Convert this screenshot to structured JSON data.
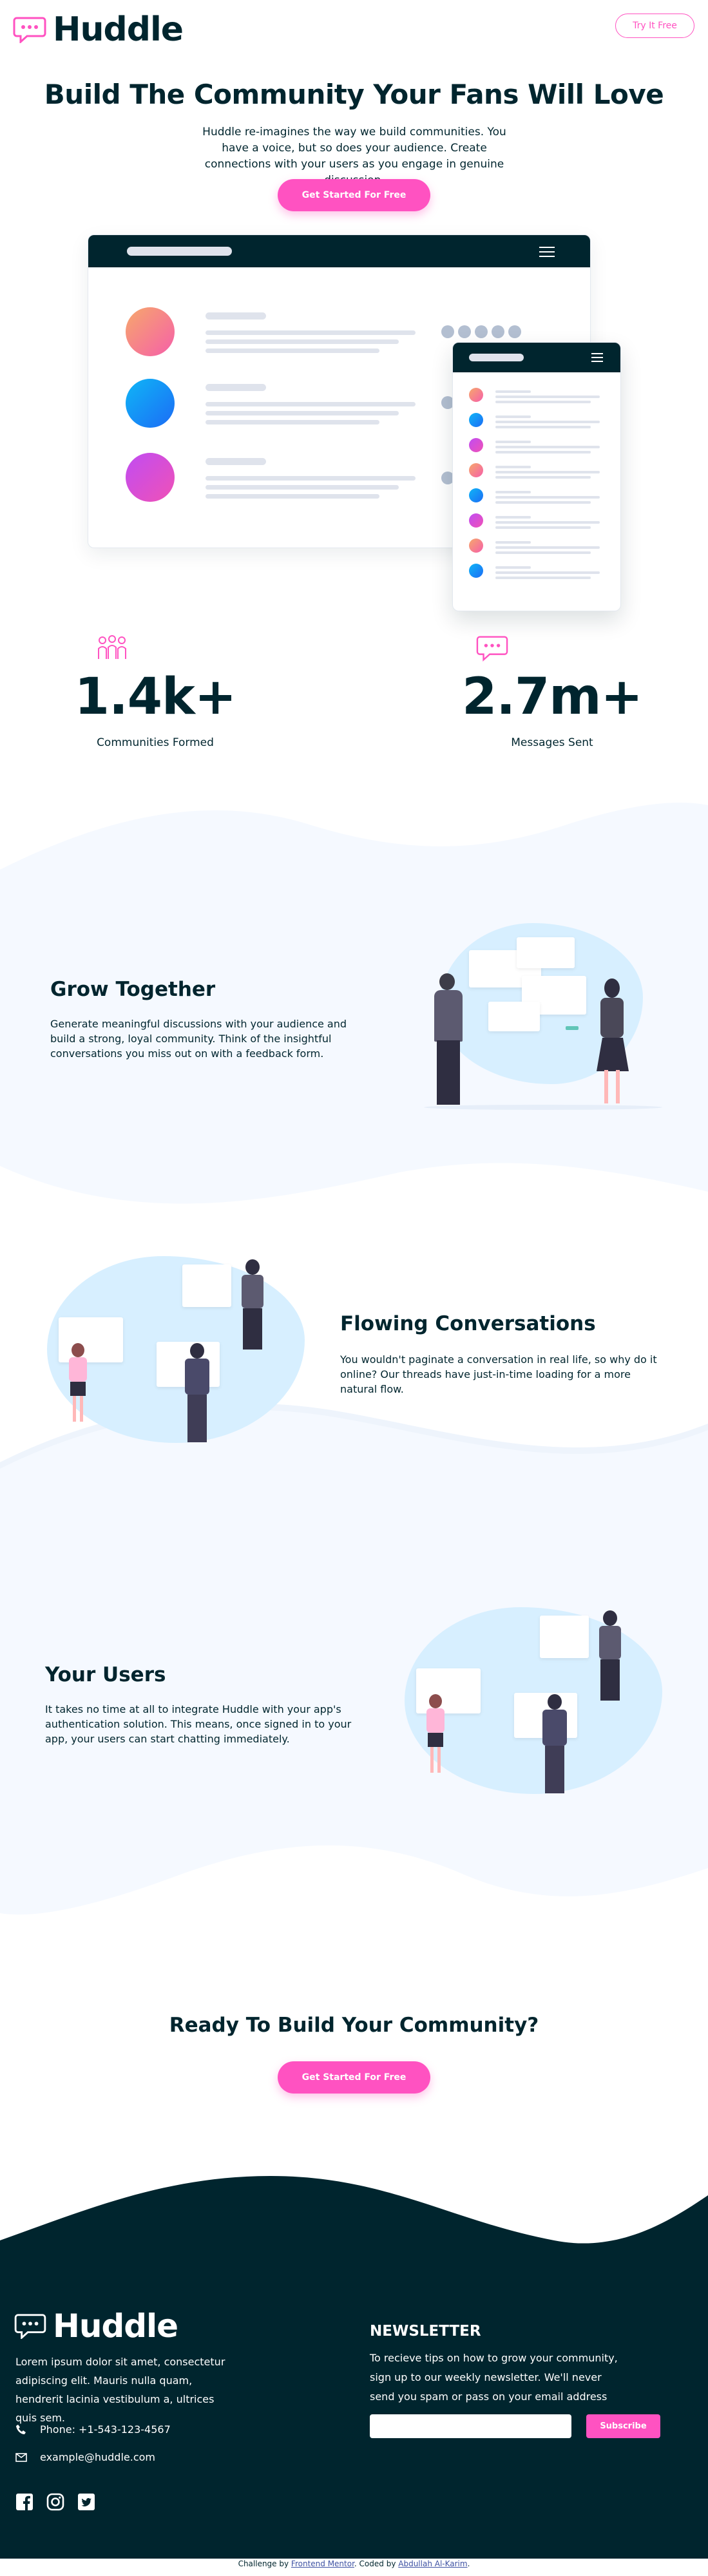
{
  "brand": {
    "name": "Huddle",
    "accent": "#ff52c1",
    "dark": "#00252e"
  },
  "header": {
    "cta": "Try It Free"
  },
  "hero": {
    "title": "Build The Community Your Fans Will Love",
    "subtitle": "Huddle re-imagines the way we build communities. You have a voice, but so does your audience. Create connections with your users as you engage in genuine discussion.",
    "cta": "Get Started For Free"
  },
  "stats": [
    {
      "value": "1.4k+",
      "label": "Communities Formed",
      "icon": "communities-icon"
    },
    {
      "value": "2.7m+",
      "label": "Messages Sent",
      "icon": "messages-icon"
    }
  ],
  "features": [
    {
      "title": "Grow Together",
      "text": "Generate meaningful discussions with your audience and build a strong, loyal community. Think of the insightful conversations you miss out on with a feedback form."
    },
    {
      "title": "Flowing Conversations",
      "text": "You wouldn't paginate a conversation in real life, so why do it online? Our threads have just-in-time loading for a more natural flow."
    },
    {
      "title": "Your Users",
      "text": "It takes no time at all to integrate Huddle with your app's authentication solution. This means, once signed in to your app, your users can start chatting immediately."
    }
  ],
  "cta_section": {
    "title": "Ready To Build Your Community?",
    "button": "Get Started For Free"
  },
  "footer": {
    "brand": "Huddle",
    "about": "Lorem ipsum dolor sit amet, consectetur adipiscing elit. Mauris nulla quam, hendrerit lacinia vestibulum a, ultrices quis sem.",
    "phone": "Phone: +1-543-123-4567",
    "email": "example@huddle.com",
    "newsletter_title": "NEWSLETTER",
    "newsletter_text": "To recieve tips on how to grow your community, sign up to our weekly newsletter. We'll never send you spam or pass on your email address",
    "email_placeholder": "",
    "subscribe": "Subscribe",
    "socials": [
      "facebook-icon",
      "instagram-icon",
      "twitter-icon"
    ]
  },
  "credit": {
    "prefix": "Challenge by",
    "fm": "Frontend Mentor",
    "mid": ". Coded by",
    "author": "Abdullah Al-Karim",
    "end": "."
  }
}
